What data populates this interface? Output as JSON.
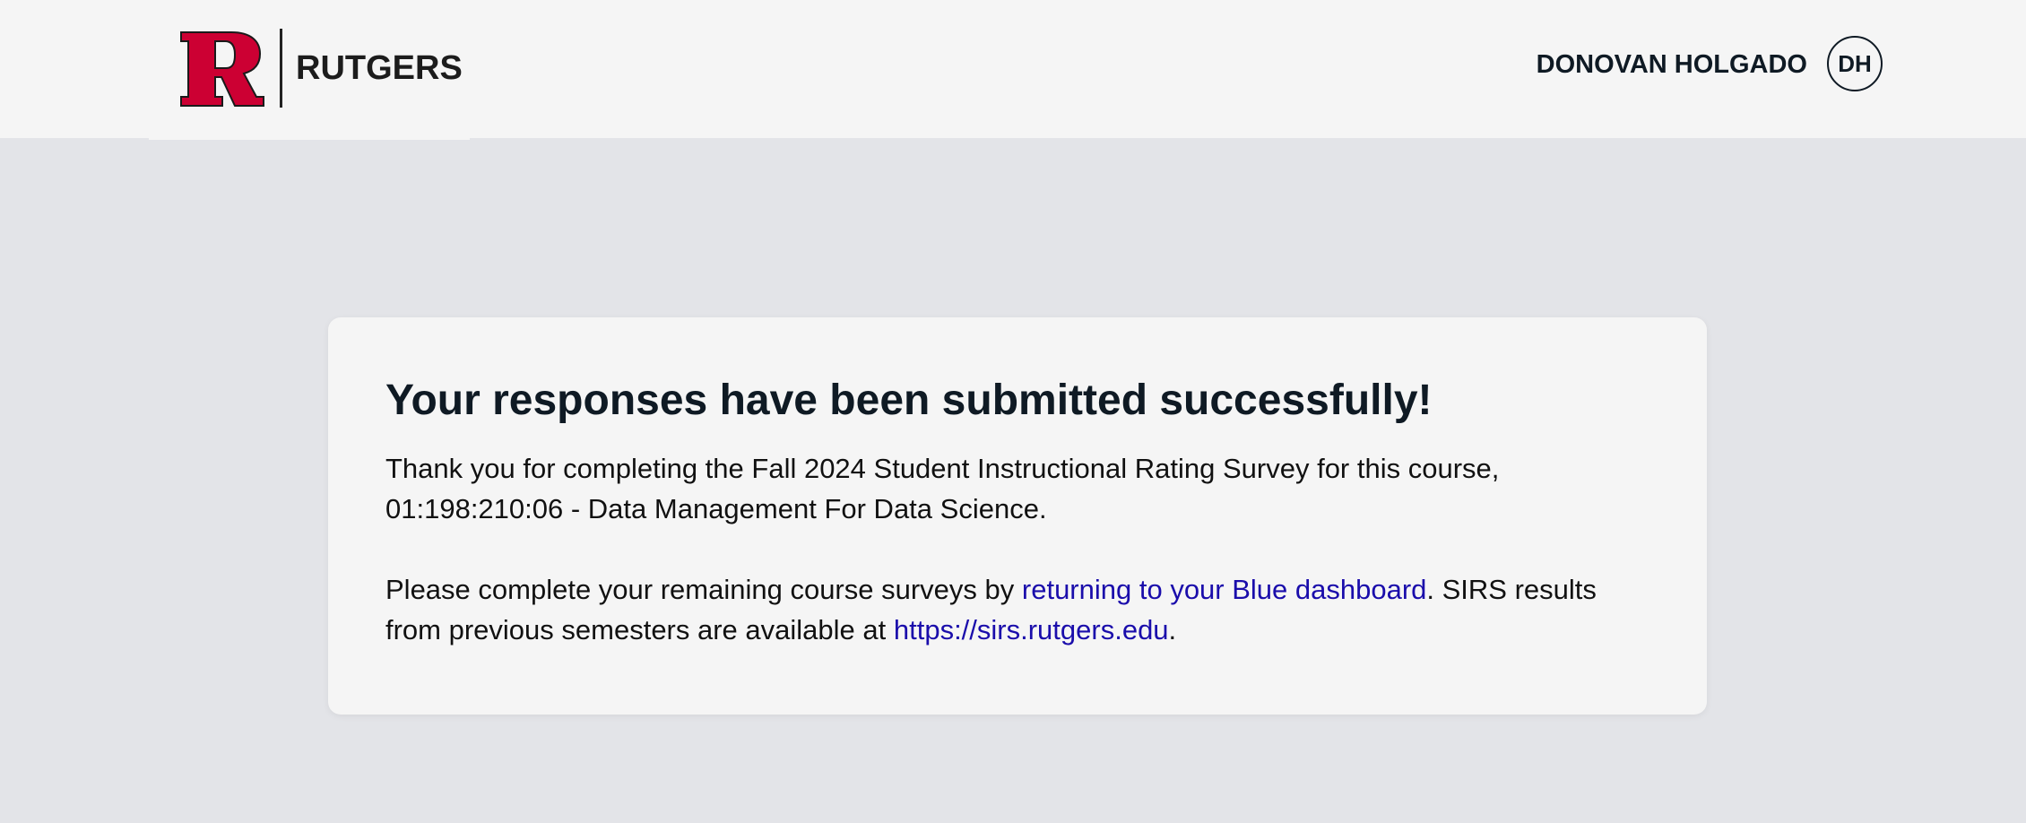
{
  "header": {
    "logo_text": "RUTGERS",
    "user_name": "DONOVAN HOLGADO",
    "user_initials": "DH"
  },
  "colors": {
    "brand_red": "#cc0033",
    "link": "#1a0dab",
    "background": "#e3e4e8",
    "surface": "#f5f5f5"
  },
  "card": {
    "title": "Your responses have been submitted successfully!",
    "thanks_text": "Thank you for completing the Fall 2024 Student Instructional Rating Survey for this course, 01:198:210:06 - Data Management For Data Science.",
    "remaining_prefix": "Please complete your remaining course surveys by ",
    "dashboard_link_text": "returning to your Blue dashboard",
    "remaining_middle": ". SIRS results from previous semesters are available at ",
    "sirs_link_text": "https://sirs.rutgers.edu",
    "remaining_suffix": "."
  }
}
